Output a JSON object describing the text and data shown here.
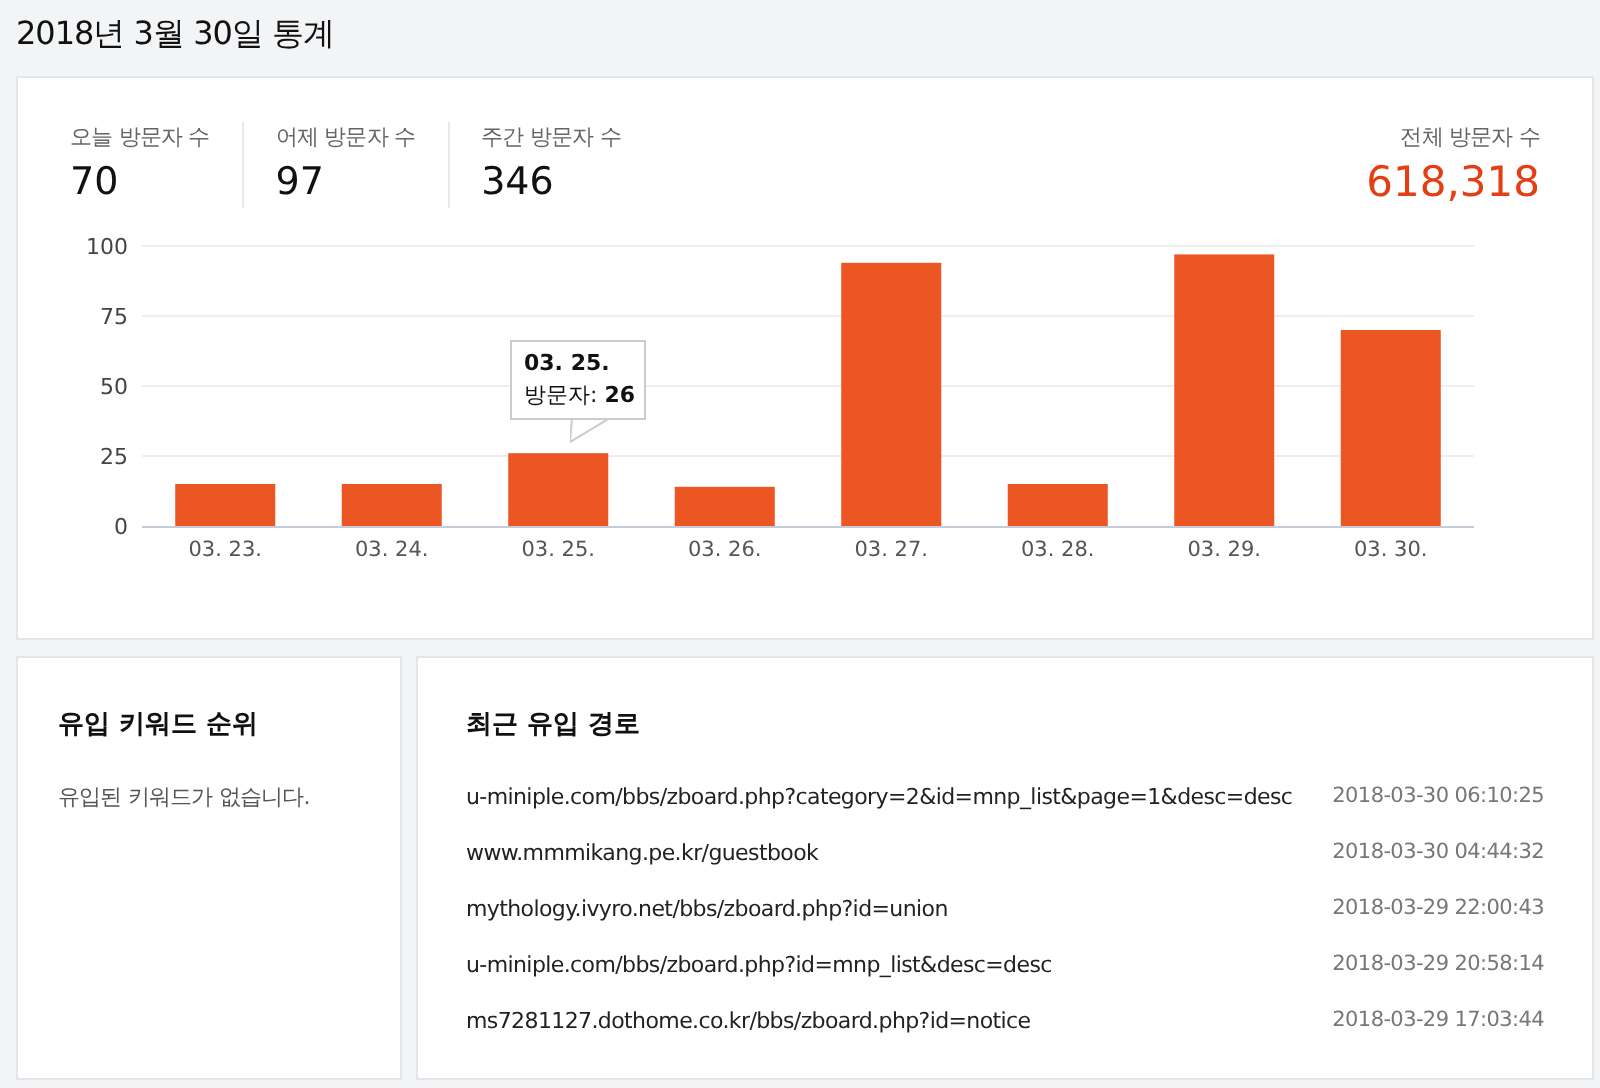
{
  "page_title": "2018년 3월 30일 통계",
  "stats": [
    {
      "label": "오늘 방문자 수",
      "value": "70"
    },
    {
      "label": "어제 방문자 수",
      "value": "97"
    },
    {
      "label": "주간 방문자 수",
      "value": "346"
    }
  ],
  "total": {
    "label": "전체 방문자 수",
    "value": "618,318"
  },
  "chart_data": {
    "type": "bar",
    "categories": [
      "03. 23.",
      "03. 24.",
      "03. 25.",
      "03. 26.",
      "03. 27.",
      "03. 28.",
      "03. 29.",
      "03. 30."
    ],
    "series": [
      {
        "color": "#eb5623",
        "values": [
          15,
          15,
          26,
          14,
          94,
          15,
          97,
          70
        ]
      }
    ],
    "ylim": [
      0,
      100
    ],
    "yticks": [
      0,
      25,
      50,
      75,
      100
    ],
    "grid": true
  },
  "tooltip": {
    "title": "03. 25.",
    "text": "방문자: **26**"
  },
  "keywords": {
    "title": "유입 키워드 순위",
    "empty_text": "유입된 키워드가 없습니다."
  },
  "referrers": {
    "title": "최근 유입 경로",
    "items": [
      {
        "url": "u-miniple.com/bbs/zboard.php?category=2&id=mnp_list&page=1&desc=desc",
        "time": "2018-03-30 06:10:25"
      },
      {
        "url": "www.mmmikang.pe.kr/guestbook",
        "time": "2018-03-30 04:44:32"
      },
      {
        "url": "mythology.ivyro.net/bbs/zboard.php?id=union",
        "time": "2018-03-29 22:00:43"
      },
      {
        "url": "u-miniple.com/bbs/zboard.php?id=mnp_list&desc=desc",
        "time": "2018-03-29 20:58:14"
      },
      {
        "url": "ms7281127.dothome.co.kr/bbs/zboard.php?id=notice",
        "time": "2018-03-29 17:03:44"
      }
    ]
  }
}
